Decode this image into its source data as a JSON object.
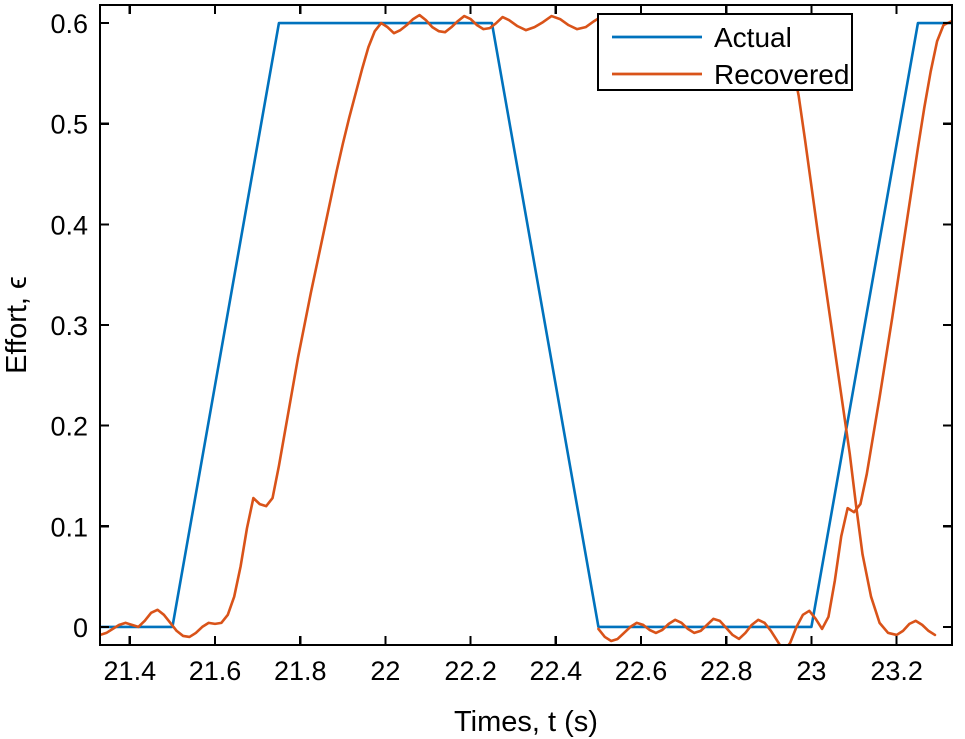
{
  "chart_data": {
    "type": "line",
    "title": "",
    "xlabel": "Times, t (s)",
    "ylabel": "Effort, ϵ",
    "xlim": [
      21.33,
      23.33
    ],
    "ylim": [
      -0.018,
      0.618
    ],
    "xticks": [
      21.4,
      21.6,
      21.8,
      22,
      22.2,
      22.4,
      22.6,
      22.8,
      23,
      23.2
    ],
    "xticklabels": [
      "21.4",
      "21.6",
      "21.8",
      "22",
      "22.2",
      "22.4",
      "22.6",
      "22.8",
      "23",
      "23.2"
    ],
    "yticks": [
      0,
      0.1,
      0.2,
      0.3,
      0.4,
      0.5,
      0.6
    ],
    "yticklabels": [
      "0",
      "0.1",
      "0.2",
      "0.3",
      "0.4",
      "0.5",
      "0.6"
    ],
    "grid": false,
    "legend": {
      "position": "top-right",
      "entries": [
        {
          "name": "Actual",
          "color": "#0072BD"
        },
        {
          "name": "Recovered",
          "color": "#D95319"
        }
      ]
    },
    "series": [
      {
        "name": "Actual",
        "color": "#0072BD",
        "description": "Ideal trapezoidal effort reference: zero baseline, linear ramp up 21.50-21.75 to 0.6, plateau 0.6 until 22.25, linear ramp down to 0 at 22.50, zero plateau until 23.00, linear ramp up to 0.6 at 23.25, plateau to end.",
        "x": [
          21.33,
          21.5,
          21.75,
          22.25,
          22.5,
          23.0,
          23.25,
          23.33
        ],
        "y": [
          0.0,
          0.0,
          0.6,
          0.6,
          0.0,
          0.0,
          0.6,
          0.6
        ]
      },
      {
        "name": "Recovered",
        "color": "#D95319",
        "description": "Noisy estimate tracking the actual trapezoid with small oscillations (amplitude about 0.01) on the plateaus and slight lag plus a notch near 0.12 on each rising edge.",
        "x": [
          21.33,
          21.345,
          21.36,
          21.375,
          21.39,
          21.405,
          21.42,
          21.435,
          21.45,
          21.465,
          21.48,
          21.495,
          21.51,
          21.525,
          21.54,
          21.555,
          21.57,
          21.585,
          21.6,
          21.615,
          21.63,
          21.645,
          21.66,
          21.675,
          21.69,
          21.705,
          21.72,
          21.735,
          21.75,
          21.765,
          21.78,
          21.795,
          21.81,
          21.825,
          21.84,
          21.855,
          21.87,
          21.885,
          21.9,
          21.915,
          21.93,
          21.945,
          21.96,
          21.975,
          21.99,
          22.005,
          22.02,
          22.035,
          22.05,
          22.065,
          22.08,
          22.095,
          22.11,
          22.125,
          22.14,
          22.155,
          22.17,
          22.185,
          22.2,
          22.215,
          22.23,
          22.245,
          22.26,
          22.275,
          22.29,
          22.31,
          22.33,
          22.35,
          22.37,
          22.39,
          22.41,
          22.43,
          22.45,
          22.47,
          22.49,
          22.505,
          22.52,
          22.535,
          22.55,
          22.565,
          22.58,
          22.595,
          22.61,
          22.625,
          22.64,
          22.655,
          22.67,
          22.685,
          22.7,
          22.715,
          22.73,
          22.745,
          22.76,
          22.775,
          22.79,
          22.805,
          22.82,
          22.835,
          22.85,
          22.865,
          22.88,
          22.895,
          22.91,
          22.925,
          22.94,
          22.955,
          22.97,
          22.985,
          23.0,
          23.015,
          23.03,
          23.045,
          23.06,
          23.075,
          23.09,
          23.105,
          23.12,
          23.14,
          23.16,
          23.18,
          23.2,
          23.215,
          23.23,
          23.245,
          23.26,
          23.275,
          23.29,
          23.305,
          23.33
        ],
        "y": [
          -0.008,
          -0.006,
          -0.002,
          0.002,
          0.004,
          0.002,
          0.0,
          0.006,
          0.014,
          0.017,
          0.012,
          0.004,
          -0.004,
          -0.009,
          -0.01,
          -0.006,
          0.0,
          0.004,
          0.003,
          0.004,
          0.012,
          0.03,
          0.06,
          0.098,
          0.128,
          0.122,
          0.12,
          0.128,
          0.16,
          0.196,
          0.232,
          0.268,
          0.3,
          0.332,
          0.362,
          0.392,
          0.422,
          0.452,
          0.48,
          0.506,
          0.53,
          0.554,
          0.576,
          0.592,
          0.6,
          0.596,
          0.59,
          0.593,
          0.598,
          0.604,
          0.608,
          0.603,
          0.596,
          0.592,
          0.591,
          0.596,
          0.602,
          0.607,
          0.604,
          0.598,
          0.594,
          0.595,
          0.6,
          0.606,
          0.603,
          0.597,
          0.593,
          0.596,
          0.601,
          0.607,
          0.604,
          0.598,
          0.594,
          0.596,
          0.602,
          0.606,
          0.601,
          0.594,
          0.59,
          0.594,
          0.601,
          0.606,
          0.602,
          0.596,
          0.592,
          0.596,
          0.603,
          0.608,
          0.605,
          0.598,
          0.592,
          0.588,
          0.594,
          0.601,
          0.607,
          0.604,
          0.596,
          0.588,
          0.583,
          0.589,
          0.598,
          0.604,
          0.6,
          0.59,
          0.578,
          0.56,
          0.528,
          0.484,
          0.438,
          0.392,
          0.348,
          0.304,
          0.26,
          0.216,
          0.172,
          0.12,
          0.072,
          0.03,
          0.004,
          -0.006,
          -0.008,
          -0.004,
          0.003,
          0.006,
          0.002,
          -0.004,
          -0.008
        ],
        "y_note": "second half of series continues in y2",
        "x2": [
          22.5,
          22.515,
          22.53,
          22.545,
          22.56,
          22.575,
          22.59,
          22.605,
          22.62,
          22.635,
          22.65,
          22.665,
          22.68,
          22.695,
          22.71,
          22.725,
          22.74,
          22.755,
          22.77,
          22.785,
          22.8,
          22.815,
          22.83,
          22.845,
          22.86,
          22.875,
          22.89,
          22.905,
          22.92,
          22.935,
          22.95,
          22.965,
          22.98,
          22.995,
          23.01,
          23.025,
          23.04,
          23.055,
          23.07,
          23.085,
          23.1,
          23.115,
          23.13,
          23.145,
          23.16,
          23.175,
          23.19,
          23.205,
          23.22,
          23.235,
          23.25,
          23.265,
          23.28,
          23.295,
          23.31,
          23.33
        ],
        "y2": [
          -0.002,
          -0.01,
          -0.014,
          -0.012,
          -0.006,
          0.0,
          0.004,
          0.002,
          -0.003,
          -0.006,
          -0.003,
          0.003,
          0.007,
          0.004,
          -0.002,
          -0.006,
          -0.004,
          0.002,
          0.008,
          0.006,
          -0.001,
          -0.008,
          -0.012,
          -0.006,
          0.002,
          0.007,
          0.004,
          -0.004,
          -0.014,
          -0.024,
          -0.016,
          0.0,
          0.012,
          0.016,
          0.008,
          -0.002,
          0.01,
          0.046,
          0.09,
          0.118,
          0.114,
          0.122,
          0.152,
          0.19,
          0.228,
          0.268,
          0.308,
          0.35,
          0.392,
          0.434,
          0.476,
          0.516,
          0.552,
          0.582,
          0.598,
          0.602
        ]
      }
    ]
  }
}
